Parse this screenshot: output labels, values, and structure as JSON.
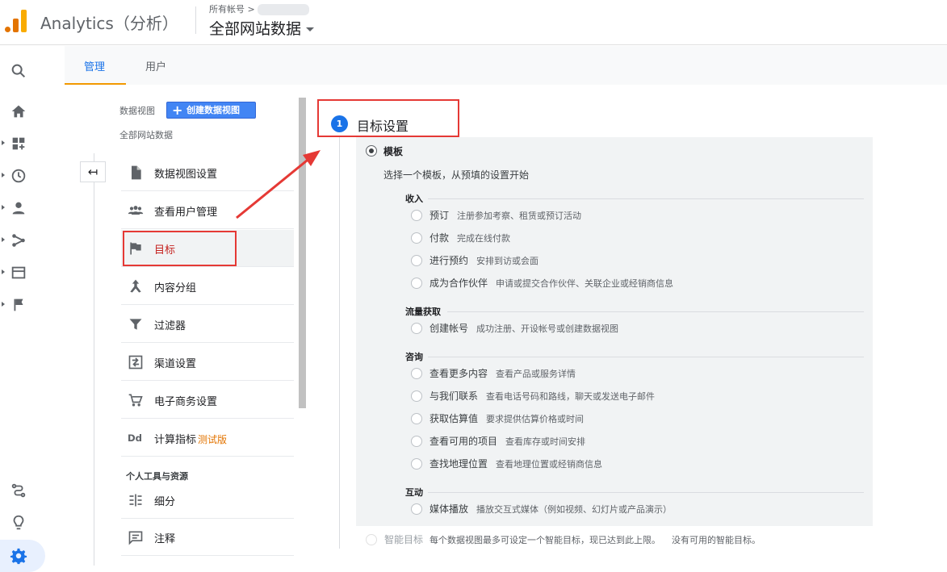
{
  "header": {
    "app_title": "Analytics（分析）",
    "account_crumb": "所有帐号 >",
    "property_name": "全部网站数据"
  },
  "tabs": [
    {
      "label": "管理",
      "active": true
    },
    {
      "label": "用户",
      "active": false
    }
  ],
  "admin": {
    "view_label": "数据视图",
    "create_button": "创建数据视图",
    "view_name": "全部网站数据",
    "back_glyph": "↤",
    "menu": [
      {
        "label": "数据视图设置",
        "icon": "document-icon"
      },
      {
        "label": "查看用户管理",
        "icon": "people-icon"
      },
      {
        "label": "目标",
        "icon": "flag-icon",
        "active": true
      },
      {
        "label": "内容分组",
        "icon": "grouping-icon"
      },
      {
        "label": "过滤器",
        "icon": "filter-icon"
      },
      {
        "label": "渠道设置",
        "icon": "channel-icon"
      },
      {
        "label": "电子商务设置",
        "icon": "cart-icon"
      },
      {
        "label": "计算指标",
        "icon": "dd-icon",
        "badge": "测试版"
      }
    ],
    "section_personal": "个人工具与资源",
    "personal_menu": [
      {
        "label": "细分",
        "icon": "segment-icon"
      },
      {
        "label": "注释",
        "icon": "comment-icon"
      }
    ]
  },
  "goal_setup": {
    "step_number": "1",
    "title": "目标设置",
    "template_label": "模板",
    "template_desc": "选择一个模板，从预填的设置开始",
    "categories": [
      {
        "name": "收入",
        "options": [
          {
            "name": "预订",
            "desc": "注册参加考察、租赁或预订活动"
          },
          {
            "name": "付款",
            "desc": "完成在线付款"
          },
          {
            "name": "进行预约",
            "desc": "安排到访或会面"
          },
          {
            "name": "成为合作伙伴",
            "desc": "申请或提交合作伙伴、关联企业或经销商信息"
          }
        ]
      },
      {
        "name": "流量获取",
        "options": [
          {
            "name": "创建帐号",
            "desc": "成功注册、开设帐号或创建数据视图"
          }
        ]
      },
      {
        "name": "咨询",
        "options": [
          {
            "name": "查看更多内容",
            "desc": "查看产品或服务详情"
          },
          {
            "name": "与我们联系",
            "desc": "查看电话号码和路线，聊天或发送电子邮件"
          },
          {
            "name": "获取估算值",
            "desc": "要求提供估算价格或时间"
          },
          {
            "name": "查看可用的项目",
            "desc": "查看库存或时间安排"
          },
          {
            "name": "查找地理位置",
            "desc": "查看地理位置或经销商信息"
          }
        ]
      },
      {
        "name": "互动",
        "options": [
          {
            "name": "媒体播放",
            "desc": "播放交互式媒体（例如视频、幻灯片或产品演示）"
          }
        ]
      }
    ],
    "smart_goal": {
      "name": "智能目标",
      "desc": "每个数据视图最多可设定一个智能目标，现已达到此上限。",
      "none": "没有可用的智能目标。"
    }
  }
}
